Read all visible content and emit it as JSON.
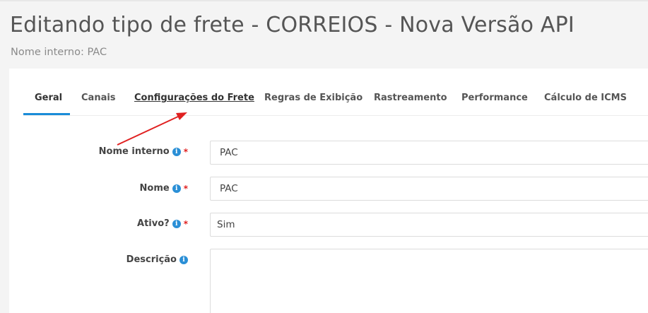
{
  "header": {
    "title": "Editando tipo de frete - CORREIOS - Nova Versão API",
    "subtitle": "Nome interno: PAC"
  },
  "tabs": [
    {
      "label": "Geral",
      "active": true
    },
    {
      "label": "Canais"
    },
    {
      "label": "Configurações do Frete",
      "underlined": true
    },
    {
      "label": "Regras de Exibição"
    },
    {
      "label": "Rastreamento"
    },
    {
      "label": "Performance"
    },
    {
      "label": "Cálculo de ICMS"
    }
  ],
  "form": {
    "nome_interno": {
      "label": "Nome interno",
      "value": "PAC",
      "required": true
    },
    "nome": {
      "label": "Nome",
      "value": "PAC",
      "required": true
    },
    "ativo": {
      "label": "Ativo?",
      "value": "Sim",
      "required": true
    },
    "descricao": {
      "label": "Descrição",
      "value": ""
    }
  },
  "icons": {
    "info": "info-icon",
    "required": "*"
  },
  "colors": {
    "accent": "#1a8cd8",
    "required": "#e02020",
    "annotation_arrow": "#e02020"
  }
}
